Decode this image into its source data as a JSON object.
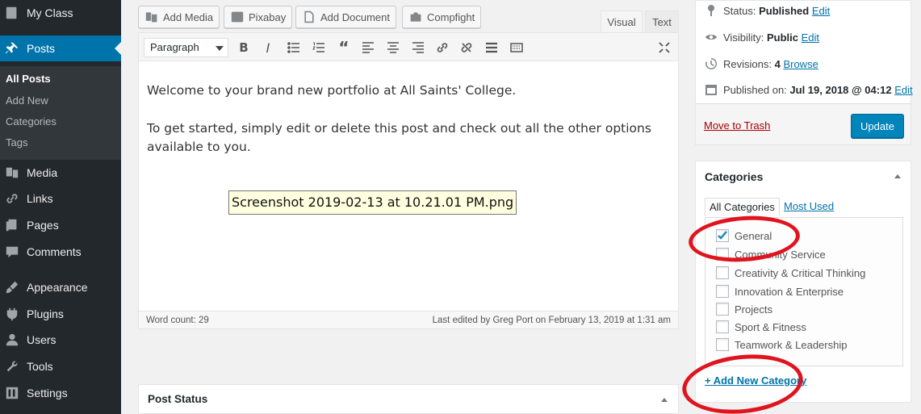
{
  "sidebar": {
    "items": [
      {
        "label": "My Class",
        "icon": "dashboard-icon"
      },
      {
        "label": "Posts",
        "icon": "pushpin-icon"
      },
      {
        "label": "Media",
        "icon": "media-icon"
      },
      {
        "label": "Links",
        "icon": "link-icon"
      },
      {
        "label": "Pages",
        "icon": "pages-icon"
      },
      {
        "label": "Comments",
        "icon": "comment-icon"
      },
      {
        "label": "Appearance",
        "icon": "brush-icon"
      },
      {
        "label": "Plugins",
        "icon": "plug-icon"
      },
      {
        "label": "Users",
        "icon": "user-icon"
      },
      {
        "label": "Tools",
        "icon": "wrench-icon"
      },
      {
        "label": "Settings",
        "icon": "settings-icon"
      }
    ],
    "submenu": [
      "All Posts",
      "Add New",
      "Categories",
      "Tags"
    ],
    "active_color": "#0073aa"
  },
  "editor": {
    "media_buttons": [
      "Add Media",
      "Pixabay",
      "Add Document",
      "Compfight"
    ],
    "tabs": {
      "visual": "Visual",
      "text": "Text"
    },
    "format_select": "Paragraph",
    "paragraphs": [
      "Welcome to your brand new portfolio at All Saints' College.",
      "To get started, simply edit or delete this post and check out all the other options available to you."
    ],
    "file_label": "Screenshot 2019-02-13 at 10.21.01 PM.png",
    "word_count": "Word count: 29",
    "last_edited": "Last edited by Greg Port on February 13, 2019 at 1:31 am"
  },
  "post_status_box": {
    "title": "Post Status"
  },
  "publish": {
    "status_label": "Status:",
    "status_value": "Published",
    "visibility_label": "Visibility:",
    "visibility_value": "Public",
    "revisions_label": "Revisions:",
    "revisions_value": "4",
    "published_label": "Published on:",
    "published_value": "Jul 19, 2018 @ 04:12",
    "edit_link": "Edit",
    "browse_link": "Browse",
    "trash_link": "Move to Trash",
    "update_button": "Update"
  },
  "categories": {
    "title": "Categories",
    "tabs": [
      "All Categories",
      "Most Used"
    ],
    "items": [
      {
        "label": "General",
        "checked": true
      },
      {
        "label": "Community Service",
        "checked": false
      },
      {
        "label": "Creativity & Critical Thinking",
        "checked": false
      },
      {
        "label": "Innovation & Enterprise",
        "checked": false
      },
      {
        "label": "Projects",
        "checked": false
      },
      {
        "label": "Sport & Fitness",
        "checked": false
      },
      {
        "label": "Teamwork & Leadership",
        "checked": false
      }
    ],
    "add_new": "+ Add New Category"
  },
  "annotation_color": "#e0141e"
}
